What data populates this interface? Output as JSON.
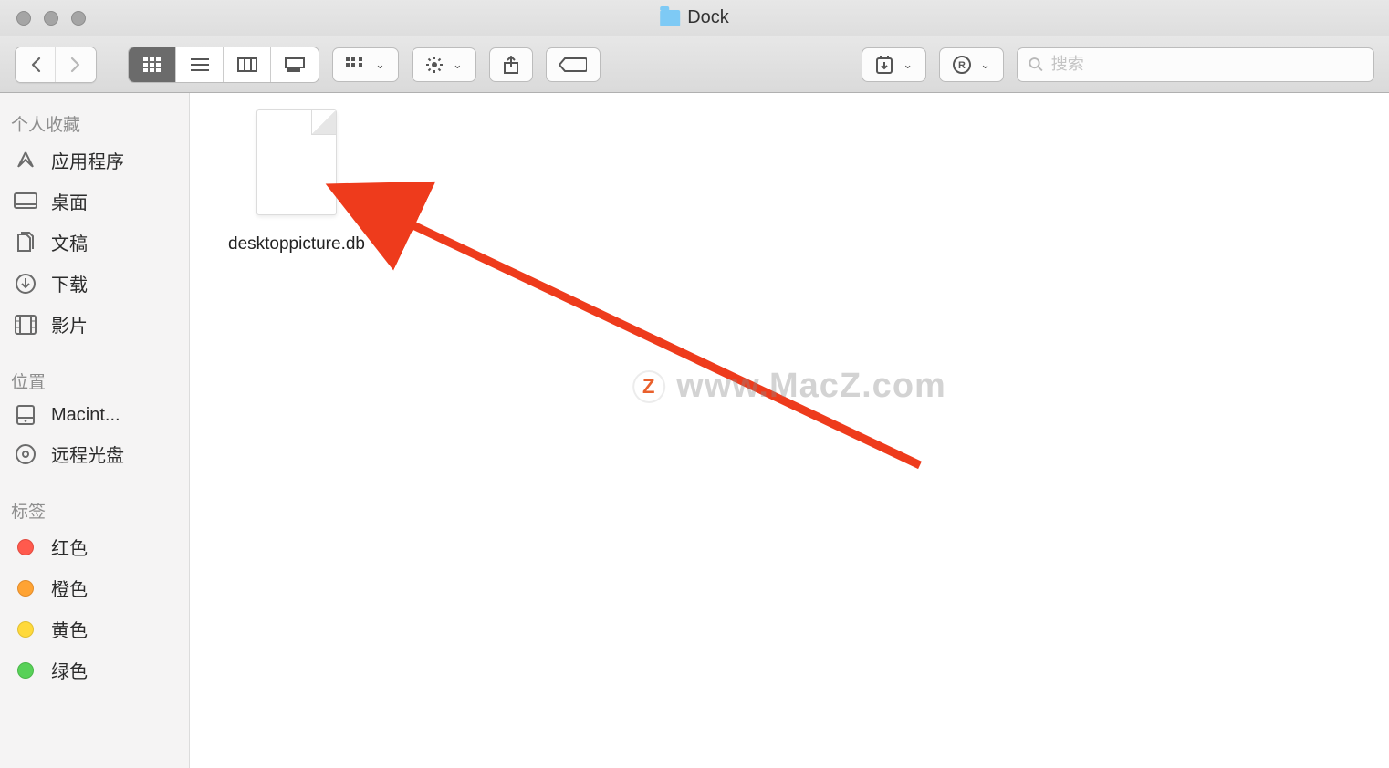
{
  "title": "Dock",
  "search": {
    "placeholder": "搜索"
  },
  "sidebar": {
    "sections": [
      {
        "header": "个人收藏",
        "items": [
          {
            "label": "应用程序",
            "icon": "app-icon"
          },
          {
            "label": "桌面",
            "icon": "desktop-icon"
          },
          {
            "label": "文稿",
            "icon": "documents-icon"
          },
          {
            "label": "下载",
            "icon": "downloads-icon"
          },
          {
            "label": "影片",
            "icon": "movies-icon"
          }
        ]
      },
      {
        "header": "位置",
        "items": [
          {
            "label": "Macint...",
            "icon": "hdd-icon"
          },
          {
            "label": "远程光盘",
            "icon": "disc-icon"
          }
        ]
      },
      {
        "header": "标签",
        "items": [
          {
            "label": "红色",
            "color": "red"
          },
          {
            "label": "橙色",
            "color": "orange"
          },
          {
            "label": "黄色",
            "color": "yellow"
          },
          {
            "label": "绿色",
            "color": "green"
          }
        ]
      }
    ]
  },
  "files": [
    {
      "name": "desktoppicture.db"
    }
  ],
  "watermark": "www.MacZ.com"
}
